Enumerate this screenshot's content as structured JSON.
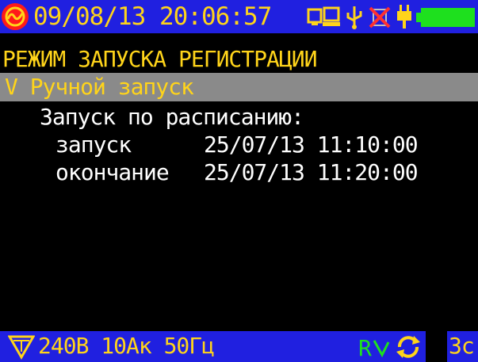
{
  "status_bar": {
    "datetime": "09/08/13 20:06:57",
    "icons": [
      "logo-icon",
      "display-link-icon",
      "usb-icon",
      "card-disabled-icon",
      "power-plug-icon",
      "battery-icon"
    ],
    "colors": {
      "bar": "#2020e0",
      "text": "#ffd41a",
      "battery": "#1ee01e",
      "logo": "#ff1a1a"
    }
  },
  "screen": {
    "title": "РЕЖИМ ЗАПУСКА РЕГИСТРАЦИИ",
    "selected_item": "V Ручной запуск",
    "schedule_heading": "Запуск по расписанию:",
    "start_label": "запуск",
    "start_value": "25/07/13 11:10:00",
    "end_label": "окончание",
    "end_value": "25/07/13 11:20:00"
  },
  "bottom_bar": {
    "measure": "240В 10Ак 50Гц",
    "rate": "3с",
    "icons": [
      "wiring-triangle-icon",
      "recording-icon",
      "refresh-icon"
    ]
  }
}
